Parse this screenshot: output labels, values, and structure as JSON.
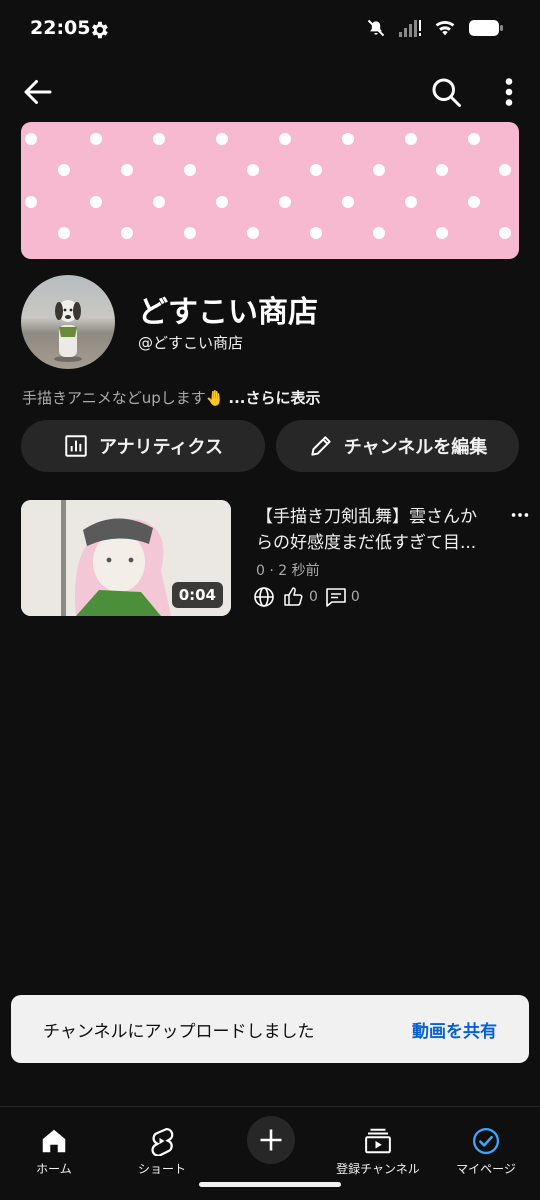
{
  "status_bar": {
    "time": "22:05"
  },
  "channel": {
    "name": "どすこい商店",
    "handle": "@どすこい商店",
    "description": "手描きアニメなどupします🤚",
    "more_label": "...さらに表示"
  },
  "actions": {
    "analytics_label": "アナリティクス",
    "edit_label": "チャンネルを編集"
  },
  "video": {
    "title": "【手描き刀剣乱舞】雲さんからの好感度まだ低すぎて目...",
    "meta": "0 · 2 秒前",
    "duration": "0:04",
    "likes": "0",
    "comments": "0"
  },
  "toast": {
    "message": "チャンネルにアップロードしました",
    "action": "動画を共有"
  },
  "bottom_nav": {
    "items": [
      {
        "label": "ホーム",
        "icon": "home-icon"
      },
      {
        "label": "ショート",
        "icon": "shorts-icon"
      },
      {
        "label": "",
        "icon": "plus-icon"
      },
      {
        "label": "登録チャンネル",
        "icon": "subscriptions-icon"
      },
      {
        "label": "マイページ",
        "icon": "you-icon"
      }
    ]
  },
  "colors": {
    "background": "#0f0f0f",
    "banner_pink": "#f6b9d0",
    "pill_bg": "#272727",
    "toast_bg": "#f1f1f1",
    "toast_action": "#065fd4",
    "mypage_accent": "#3ea6ff"
  }
}
